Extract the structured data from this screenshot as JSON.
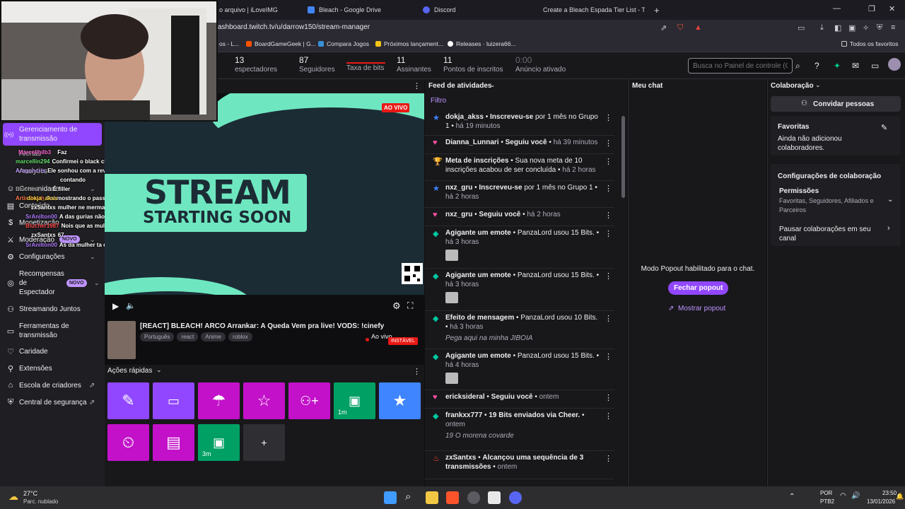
{
  "browser": {
    "tabs": [
      {
        "label": "o arquivo | iLoveIMG",
        "color": "#d9d9d9"
      },
      {
        "label": "Bleach - Google Drive",
        "color": "#4285f4"
      },
      {
        "label": "Discord",
        "color": "#5865f2"
      },
      {
        "label": "Create a Bleach Espada Tier List - Tie",
        "color": "#888888"
      }
    ],
    "new_tab": "+",
    "url": "ashboard.twitch.tv/u/darrow150/stream-manager",
    "bookmarks": [
      {
        "label": "os - L...",
        "color": "#888888"
      },
      {
        "label": "BoardGameGeek | G...",
        "color": "#ff5100"
      },
      {
        "label": "Compara Jogos",
        "color": "#3a8fd8"
      },
      {
        "label": "Próximos lançament...",
        "color": "#f5c518"
      },
      {
        "label": "Releases · luizera66...",
        "color": "#ffffff"
      }
    ],
    "all_bookmarks": "Todos os favoritos"
  },
  "stats": [
    {
      "value": "13",
      "label": "espectadores"
    },
    {
      "value": "87",
      "label": "Seguidores"
    },
    {
      "value": "",
      "label": "Taxa de bits"
    },
    {
      "value": "11",
      "label": "Assinantes"
    },
    {
      "value": "11",
      "label": "Pontos de inscritos"
    },
    {
      "value": "0:00",
      "label": "Anúncio ativado"
    }
  ],
  "dashboard_search": {
    "placeholder": "Busca no Painel de controle (C"
  },
  "sidebar": {
    "items": [
      {
        "label": "Gerenciamento de transmissão",
        "icon": "((•))"
      },
      {
        "label": "Comunidade",
        "icon": "☺"
      },
      {
        "label": "Conteúdo",
        "icon": "▤"
      },
      {
        "label": "Monetização",
        "icon": "$"
      },
      {
        "label": "Moderação",
        "icon": "⚔"
      },
      {
        "label": "Configurações",
        "icon": "⚙"
      },
      {
        "label": "Recompensas de Espectador",
        "icon": "◎"
      },
      {
        "label": "Streamando Juntos",
        "icon": "⚇"
      },
      {
        "label": "Ferramentas de transmissão",
        "icon": "▭"
      },
      {
        "label": "Caridade",
        "icon": "♡"
      },
      {
        "label": "Extensões",
        "icon": "⚲"
      },
      {
        "label": "Escola de criadores",
        "icon": "⌂"
      },
      {
        "label": "Central de segurança",
        "icon": "⛨"
      }
    ],
    "alerts_label": "Alertas",
    "analytics_label": "Analytics",
    "novo_badge": "NOVO"
  },
  "chat_overlay": [
    {
      "user": "Marcellbilb3",
      "msg": "Faz",
      "color": "#ff6ad5"
    },
    {
      "user": "marcellin294",
      "msg": "Confirmei o black clover la no discord @darr",
      "color": "#69e36f"
    },
    {
      "user": "Aragoncris",
      "msg": "Ele sonhou com a revolta antiga deles lá q o",
      "color": "#c5a3ff"
    },
    {
      "user": "",
      "msg": "contando",
      "color": "#ffffff"
    },
    {
      "user": "Blucher",
      "msg": "É filler",
      "color": "#aaaaaa"
    },
    {
      "user": "ArtinDeath",
      "msg": "Foi mostrando o passado do Senhor ele",
      "color": "#ff7a45"
    },
    {
      "user": "dokja_akss",
      "msg": "",
      "color": "#ffd84a"
    },
    {
      "user": "zxSantxs",
      "msg": "mulher ne merma",
      "color": "#ffffff"
    },
    {
      "user": "SrAnilton00",
      "msg": "A das gurias não tava no arco",
      "color": "#b07cff"
    },
    {
      "user": "Blucher1987",
      "msg": "Nois que as mulé",
      "color": "#ff4d4d"
    },
    {
      "user": "zxSantxs",
      "msg": "67",
      "color": "#ffffff"
    },
    {
      "user": "SrAnilton00",
      "msg": "As da mulher ta cheio de spoiler",
      "color": "#b07cff"
    }
  ],
  "video": {
    "live_badge": "AO VIVO",
    "title_line1": "STREAM",
    "title_line2": "STARTING SOON"
  },
  "stream_info": {
    "title": "[REACT] BLEACH! ARCO Arrankar: A Queda Vem pra live! VODS: !cinefy",
    "tags": [
      "Português",
      "react",
      "Anime",
      "roblox"
    ],
    "status": "Ao vivo",
    "health": "INSTÁVEL"
  },
  "quick_actions": {
    "title": "Ações rápidas",
    "tiles": [
      {
        "icon": "✎",
        "color": "#9147ff",
        "sub": ""
      },
      {
        "icon": "🎬",
        "color": "#9147ff",
        "sub": ""
      },
      {
        "icon": "☂",
        "color": "#c211c9",
        "sub": ""
      },
      {
        "icon": "☆",
        "color": "#c211c9",
        "sub": ""
      },
      {
        "icon": "⚇+",
        "color": "#c211c9",
        "sub": ""
      },
      {
        "icon": "💵",
        "color": "#00a064",
        "sub": "1m"
      },
      {
        "icon": "★",
        "color": "#3f85ff",
        "sub": ""
      },
      {
        "icon": "⏲",
        "color": "#c211c9",
        "sub": ""
      },
      {
        "icon": "▤",
        "color": "#c211c9",
        "sub": ""
      },
      {
        "icon": "💵",
        "color": "#00a064",
        "sub": "3m"
      },
      {
        "icon": "+",
        "color": "#2e2e33",
        "sub": ""
      }
    ]
  },
  "feed": {
    "title": "Feed de atividades",
    "filter": "Filtro",
    "items": [
      {
        "icon": "★",
        "icon_color": "#3f85ff",
        "user": "dokja_akss",
        "action": "Inscreveu-se",
        "detail": "por 1 mês no Grupo 1",
        "time": "há 19 minutos",
        "msg": "",
        "emote": false
      },
      {
        "icon": "♥",
        "icon_color": "#ff4fa0",
        "user": "Dianna_Lunnari",
        "action": "Seguiu você",
        "detail": "",
        "time": "há 39 minutos",
        "msg": "",
        "emote": false
      },
      {
        "icon": "🏆",
        "icon_color": "#00c8a0",
        "user": "Meta de inscrições",
        "action": "",
        "detail": "Sua nova meta de 10 inscrições acabou de ser concluída",
        "time": "há 2 horas",
        "msg": "",
        "emote": false
      },
      {
        "icon": "★",
        "icon_color": "#3f85ff",
        "user": "nxz_gru",
        "action": "Inscreveu-se",
        "detail": "por 1 mês no Grupo 1",
        "time": "há 2 horas",
        "msg": "",
        "emote": false
      },
      {
        "icon": "♥",
        "icon_color": "#ff4fa0",
        "user": "nxz_gru",
        "action": "Seguiu você",
        "detail": "",
        "time": "há 2 horas",
        "msg": "",
        "emote": false
      },
      {
        "icon": "◆",
        "icon_color": "#00c8a0",
        "user": "Agigante um emote",
        "action": "",
        "detail": "PanzaLord usou 15 Bits.",
        "time": "há 3 horas",
        "msg": "",
        "emote": true
      },
      {
        "icon": "◆",
        "icon_color": "#00c8a0",
        "user": "Agigante um emote",
        "action": "",
        "detail": "PanzaLord usou 15 Bits.",
        "time": "há 3 horas",
        "msg": "",
        "emote": true
      },
      {
        "icon": "◆",
        "icon_color": "#00c8a0",
        "user": "Efeito de mensagem",
        "action": "",
        "detail": "PanzaLord usou 10 Bits.",
        "time": "há 3 horas",
        "msg": "Pega aqui na minha JIBOIA",
        "emote": false
      },
      {
        "icon": "◆",
        "icon_color": "#00c8a0",
        "user": "Agigante um emote",
        "action": "",
        "detail": "PanzaLord usou 15 Bits.",
        "time": "há 4 horas",
        "msg": "",
        "emote": true
      },
      {
        "icon": "♥",
        "icon_color": "#ff4fa0",
        "user": "ericksideral",
        "action": "Seguiu você",
        "detail": "",
        "time": "ontem",
        "msg": "",
        "emote": false
      },
      {
        "icon": "◆",
        "icon_color": "#00c8a0",
        "user": "frankxx777",
        "action": "19 Bits enviados via Cheer.",
        "detail": "",
        "time": "ontem",
        "msg": "19 O morena covarde",
        "emote": false
      },
      {
        "icon": "♨",
        "icon_color": "#ff4a2b",
        "user": "zxSantxs",
        "action": "Alcançou uma sequência de 3 transmissões",
        "detail": "",
        "time": "ontem",
        "msg": "",
        "emote": false
      }
    ]
  },
  "chat": {
    "title": "Meu chat",
    "popout_text": "Modo Popout habilitado para o chat.",
    "close_popout": "Fechar popout",
    "show_popout": "Mostrar popout"
  },
  "collab": {
    "title": "Colaboração",
    "invite": "Convidar pessoas",
    "favorites_title": "Favoritas",
    "favorites_desc": "Ainda não adicionou colaboradores.",
    "settings_title": "Configurações de colaboração",
    "permissions_title": "Permissões",
    "permissions_desc": "Favoritas, Seguidores, Afiliados e Parceiros",
    "pause_label": "Pausar colaborações em seu canal"
  },
  "taskbar": {
    "weather_temp": "27°C",
    "weather_desc": "Parc. nublado",
    "lang1": "POR",
    "lang2": "PTB2",
    "time": "23:50",
    "date": "13/01/2026"
  }
}
